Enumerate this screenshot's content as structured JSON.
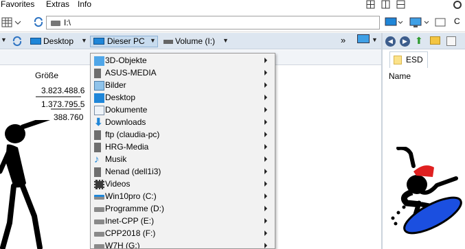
{
  "menu": {
    "favorites": "Favorites",
    "extras": "Extras",
    "info": "Info"
  },
  "address": {
    "value": "I:\\"
  },
  "breadcrumb": {
    "desktop": "Desktop",
    "this_pc": "Dieser PC",
    "volume": "Volume (I:)",
    "overflow": "»"
  },
  "left_pane": {
    "column_header": "Größe",
    "sizes": [
      "3.823.488.6",
      "1.373.795.5",
      "388.760"
    ]
  },
  "right_pane": {
    "tab_label": "ESD",
    "column_header": "Name",
    "cut_label": "C"
  },
  "dropdown_items": [
    {
      "label": "3D-Objekte",
      "icon": "3d-objects-icon"
    },
    {
      "label": "ASUS-MEDIA",
      "icon": "network-drive-icon"
    },
    {
      "label": "Bilder",
      "icon": "pictures-icon"
    },
    {
      "label": "Desktop",
      "icon": "desktop-icon"
    },
    {
      "label": "Dokumente",
      "icon": "documents-icon"
    },
    {
      "label": "Downloads",
      "icon": "downloads-icon"
    },
    {
      "label": "ftp (claudia-pc)",
      "icon": "network-drive-icon"
    },
    {
      "label": "HRG-Media",
      "icon": "network-drive-icon"
    },
    {
      "label": "Musik",
      "icon": "music-icon"
    },
    {
      "label": "Nenad (dell1i3)",
      "icon": "network-drive-icon"
    },
    {
      "label": "Videos",
      "icon": "videos-icon"
    },
    {
      "label": "Win10pro (C:)",
      "icon": "system-drive-icon"
    },
    {
      "label": "Programme (D:)",
      "icon": "drive-icon"
    },
    {
      "label": "Inet-CPP (E:)",
      "icon": "drive-icon"
    },
    {
      "label": "CPP2018 (F:)",
      "icon": "drive-icon"
    },
    {
      "label": "W7H (G:)",
      "icon": "drive-icon"
    }
  ],
  "colors": {
    "toolbar": "#dde6f0",
    "menu_bg": "#f2f2f2",
    "accent": "#1f86d8"
  }
}
